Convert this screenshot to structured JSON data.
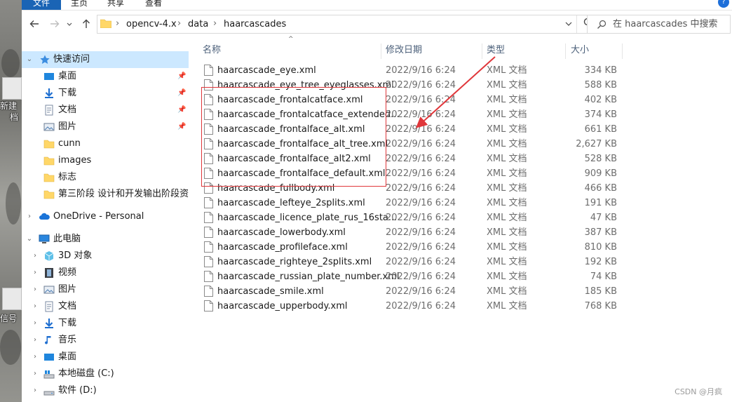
{
  "ribbon": {
    "tabs": [
      "文件",
      "主页",
      "共享",
      "查看"
    ],
    "help": "?"
  },
  "desktop": {
    "labels": [
      "新建",
      "档",
      "信号"
    ]
  },
  "address": {
    "segments": [
      "opencv-4.x",
      "data",
      "haarcascades"
    ],
    "separator": "›"
  },
  "search": {
    "placeholder": "在 haarcascades 中搜索"
  },
  "navpane": {
    "quick_access": "快速访问",
    "pinned": [
      "桌面",
      "下载",
      "文档",
      "图片"
    ],
    "folders": [
      "cunn",
      "images",
      "标志",
      "第三阶段  设计和开发输出阶段资料"
    ],
    "onedrive": "OneDrive - Personal",
    "this_pc": "此电脑",
    "pc_items": [
      "3D 对象",
      "视频",
      "图片",
      "文档",
      "下载",
      "音乐",
      "桌面",
      "本地磁盘 (C:)",
      "软件 (D:)"
    ]
  },
  "columns": {
    "name": "名称",
    "date": "修改日期",
    "type": "类型",
    "size": "大小"
  },
  "files": [
    {
      "name": "haarcascade_eye.xml",
      "date": "2022/9/16 6:24",
      "type": "XML 文档",
      "size": "334 KB"
    },
    {
      "name": "haarcascade_eye_tree_eyeglasses.xml",
      "date": "2022/9/16 6:24",
      "type": "XML 文档",
      "size": "588 KB"
    },
    {
      "name": "haarcascade_frontalcatface.xml",
      "date": "2022/9/16 6:24",
      "type": "XML 文档",
      "size": "402 KB"
    },
    {
      "name": "haarcascade_frontalcatface_extended...",
      "date": "2022/9/16 6:24",
      "type": "XML 文档",
      "size": "374 KB"
    },
    {
      "name": "haarcascade_frontalface_alt.xml",
      "date": "2022/9/16 6:24",
      "type": "XML 文档",
      "size": "661 KB"
    },
    {
      "name": "haarcascade_frontalface_alt_tree.xml",
      "date": "2022/9/16 6:24",
      "type": "XML 文档",
      "size": "2,627 KB"
    },
    {
      "name": "haarcascade_frontalface_alt2.xml",
      "date": "2022/9/16 6:24",
      "type": "XML 文档",
      "size": "528 KB"
    },
    {
      "name": "haarcascade_frontalface_default.xml",
      "date": "2022/9/16 6:24",
      "type": "XML 文档",
      "size": "909 KB"
    },
    {
      "name": "haarcascade_fullbody.xml",
      "date": "2022/9/16 6:24",
      "type": "XML 文档",
      "size": "466 KB"
    },
    {
      "name": "haarcascade_lefteye_2splits.xml",
      "date": "2022/9/16 6:24",
      "type": "XML 文档",
      "size": "191 KB"
    },
    {
      "name": "haarcascade_licence_plate_rus_16sta...",
      "date": "2022/9/16 6:24",
      "type": "XML 文档",
      "size": "47 KB"
    },
    {
      "name": "haarcascade_lowerbody.xml",
      "date": "2022/9/16 6:24",
      "type": "XML 文档",
      "size": "387 KB"
    },
    {
      "name": "haarcascade_profileface.xml",
      "date": "2022/9/16 6:24",
      "type": "XML 文档",
      "size": "810 KB"
    },
    {
      "name": "haarcascade_righteye_2splits.xml",
      "date": "2022/9/16 6:24",
      "type": "XML 文档",
      "size": "192 KB"
    },
    {
      "name": "haarcascade_russian_plate_number.xml",
      "date": "2022/9/16 6:24",
      "type": "XML 文档",
      "size": "74 KB"
    },
    {
      "name": "haarcascade_smile.xml",
      "date": "2022/9/16 6:24",
      "type": "XML 文档",
      "size": "185 KB"
    },
    {
      "name": "haarcascade_upperbody.xml",
      "date": "2022/9/16 6:24",
      "type": "XML 文档",
      "size": "768 KB"
    }
  ],
  "watermark": "CSDN @月疯",
  "colors": {
    "accent": "#1a64b5",
    "selection": "#cce8ff",
    "annotation": "#e0373b",
    "folder": "#ffd768",
    "header_text": "#4c607a"
  }
}
